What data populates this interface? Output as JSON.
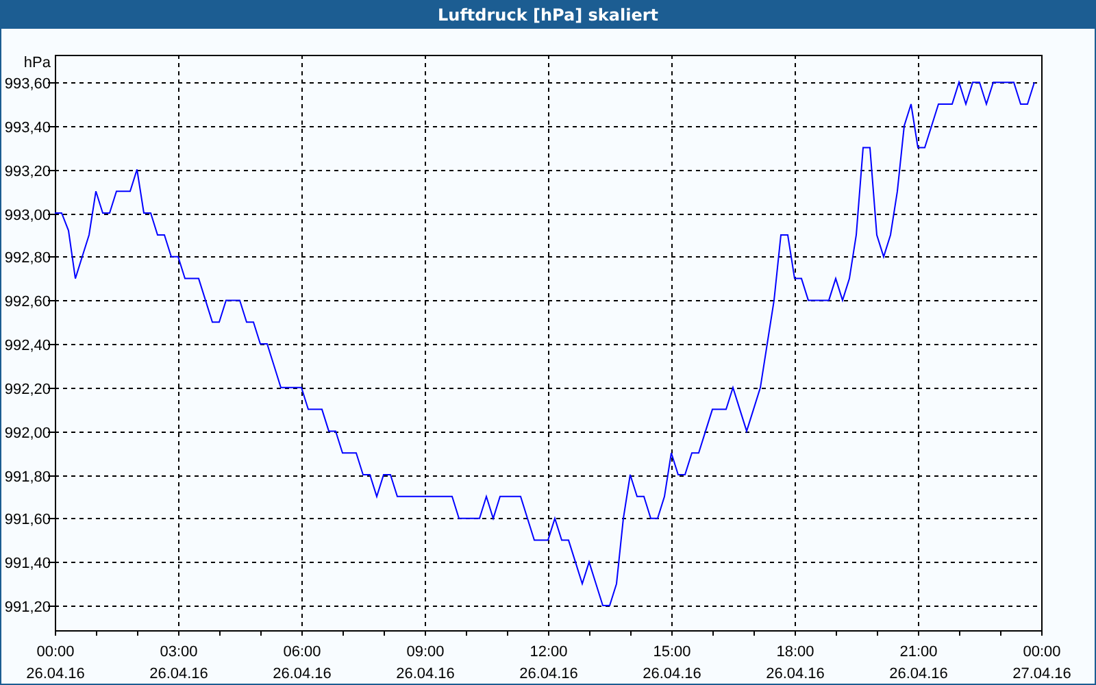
{
  "window": {
    "title": "Luftdruck [hPa] skaliert"
  },
  "chart": {
    "chart_data": {
      "type": "line",
      "grid": true,
      "ylabel": "hPa",
      "ylim": [
        991.087,
        993.726
      ],
      "yticks": [
        {
          "value": 991.2,
          "label": "991,20"
        },
        {
          "value": 991.4,
          "label": "991,40"
        },
        {
          "value": 991.6,
          "label": "991,60"
        },
        {
          "value": 991.8,
          "label": "991,80"
        },
        {
          "value": 992.0,
          "label": "992,00"
        },
        {
          "value": 992.2,
          "label": "992,20"
        },
        {
          "value": 992.4,
          "label": "992,40"
        },
        {
          "value": 992.6,
          "label": "992,60"
        },
        {
          "value": 992.8,
          "label": "992,80"
        },
        {
          "value": 993.0,
          "label": "993,00"
        },
        {
          "value": 993.2,
          "label": "993,20"
        },
        {
          "value": 993.4,
          "label": "993,40"
        },
        {
          "value": 993.6,
          "label": "993,60"
        }
      ],
      "categories": [
        "00:00 26.04.16",
        null,
        null,
        null,
        null,
        null,
        null,
        null,
        null,
        null,
        null,
        null,
        null,
        null,
        null,
        null,
        null,
        null,
        "03:00 26.04.16",
        null,
        null,
        null,
        null,
        null,
        null,
        null,
        null,
        null,
        null,
        null,
        null,
        null,
        null,
        null,
        null,
        null,
        "06:00 26.04.16",
        null,
        null,
        null,
        null,
        null,
        null,
        null,
        null,
        null,
        null,
        null,
        null,
        null,
        null,
        null,
        null,
        null,
        "09:00 26.04.16",
        null,
        null,
        null,
        null,
        null,
        null,
        null,
        null,
        null,
        null,
        null,
        null,
        null,
        null,
        null,
        null,
        null,
        "12:00 26.04.16",
        null,
        null,
        null,
        null,
        null,
        null,
        null,
        null,
        null,
        null,
        null,
        null,
        null,
        null,
        null,
        null,
        null,
        "15:00 26.04.16",
        null,
        null,
        null,
        null,
        null,
        null,
        null,
        null,
        null,
        null,
        null,
        null,
        null,
        null,
        null,
        null,
        null,
        "18:00 26.04.16",
        null,
        null,
        null,
        null,
        null,
        null,
        null,
        null,
        null,
        null,
        null,
        null,
        null,
        null,
        null,
        null,
        null,
        "21:00 26.04.16",
        null,
        null,
        null,
        null,
        null,
        null,
        null,
        null,
        null,
        null,
        null,
        null,
        null,
        null,
        null,
        null,
        null,
        "00:00 27.04.16"
      ],
      "series": [
        {
          "color": "#0000ff",
          "values": [
            993.0,
            993.0,
            992.92,
            992.7,
            992.8,
            992.9,
            993.1,
            993.0,
            993.0,
            993.1,
            993.1,
            993.1,
            993.2,
            993.0,
            993.0,
            992.9,
            992.9,
            992.8,
            992.8,
            992.7,
            992.7,
            992.7,
            992.6,
            992.5,
            992.5,
            992.6,
            992.6,
            992.6,
            992.5,
            992.5,
            992.4,
            992.4,
            992.3,
            992.2,
            992.2,
            992.2,
            992.2,
            992.1,
            992.1,
            992.1,
            992.0,
            992.0,
            991.9,
            991.9,
            991.9,
            991.8,
            991.8,
            991.7,
            991.8,
            991.8,
            991.7,
            991.7,
            991.7,
            991.7,
            991.7,
            991.7,
            991.7,
            991.7,
            991.7,
            991.6,
            991.6,
            991.6,
            991.6,
            991.7,
            991.6,
            991.7,
            991.7,
            991.7,
            991.7,
            991.6,
            991.5,
            991.5,
            991.5,
            991.6,
            991.5,
            991.5,
            991.4,
            991.3,
            991.4,
            991.3,
            991.2,
            991.2,
            991.3,
            991.6,
            991.8,
            991.7,
            991.7,
            991.6,
            991.6,
            991.7,
            991.9,
            991.8,
            991.8,
            991.9,
            991.9,
            992.0,
            992.1,
            992.1,
            992.1,
            992.2,
            992.1,
            992.0,
            992.1,
            992.2,
            992.4,
            992.6,
            992.9,
            992.9,
            992.7,
            992.7,
            992.6,
            992.6,
            992.6,
            992.6,
            992.7,
            992.6,
            992.7,
            992.9,
            993.3,
            993.3,
            992.9,
            992.8,
            992.9,
            993.1,
            993.4,
            993.5,
            993.3,
            993.3,
            993.4,
            993.5,
            993.5,
            993.5,
            993.6,
            993.5,
            993.6,
            993.6,
            993.5,
            993.6,
            993.6,
            993.6,
            993.6,
            993.5,
            993.5,
            993.6,
            null
          ]
        }
      ]
    }
  }
}
